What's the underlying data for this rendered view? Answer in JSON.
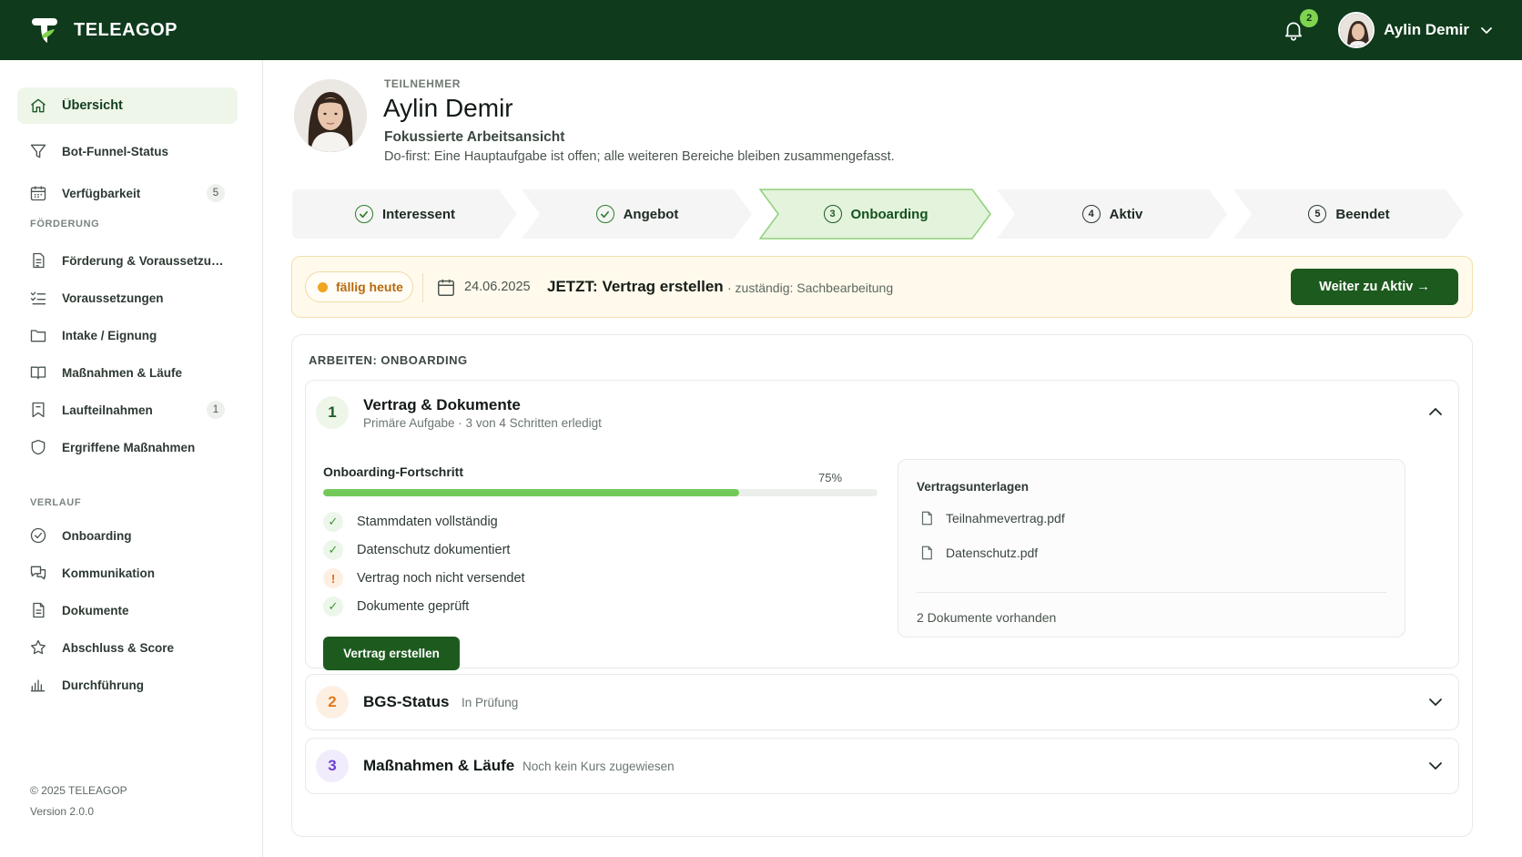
{
  "app": {
    "brand": "TELEAGOP",
    "notifications_count": "2",
    "user_name": "Aylin Demir"
  },
  "sidebar": {
    "items_top": [
      {
        "label": "Übersicht",
        "icon": "home-icon",
        "active": true
      },
      {
        "label": "Bot-Funnel-Status",
        "icon": "funnel-icon"
      },
      {
        "label": "Verfügbarkeit",
        "icon": "calendar-icon",
        "badge": "5"
      }
    ],
    "section_foerderung": "FÖRDERUNG",
    "items_foerderung": [
      {
        "label": "Förderung & Voraussetzungen",
        "icon": "document-icon"
      },
      {
        "label": "Voraussetzungen",
        "icon": "checklist-icon"
      },
      {
        "label": "Intake / Eignung",
        "icon": "folder-icon"
      },
      {
        "label": "Maßnahmen & Läufe",
        "icon": "book-icon"
      },
      {
        "label": "Laufteilnahmen",
        "icon": "bookmark-icon",
        "badge": "1"
      },
      {
        "label": "Ergriffene Maßnahmen",
        "icon": "shield-icon"
      }
    ],
    "section_verlauf": "VERLAUF",
    "items_verlauf": [
      {
        "label": "Onboarding",
        "icon": "check-circle-icon"
      },
      {
        "label": "Kommunikation",
        "icon": "chat-icon"
      },
      {
        "label": "Dokumente",
        "icon": "file-icon"
      },
      {
        "label": "Abschluss & Score",
        "icon": "star-icon"
      },
      {
        "label": "Durchführung",
        "icon": "bar-chart-icon"
      }
    ],
    "footer_copyright": "© 2025 TELEAGOP",
    "footer_version": "Version 2.0.0"
  },
  "profile": {
    "kicker": "TEILNEHMER",
    "name": "Aylin Demir",
    "subtitle": "Fokussierte Arbeitsansicht",
    "description": "Do-first: Eine Hauptaufgabe ist offen; alle weiteren Bereiche bleiben zusammengefasst."
  },
  "stepper": [
    {
      "label": "Interessent",
      "marker": "check",
      "state": "done"
    },
    {
      "label": "Angebot",
      "marker": "check",
      "state": "done"
    },
    {
      "label": "Onboarding",
      "marker": "3",
      "state": "current"
    },
    {
      "label": "Aktiv",
      "marker": "4",
      "state": "upcoming"
    },
    {
      "label": "Beendet",
      "marker": "5",
      "state": "upcoming"
    }
  ],
  "alert": {
    "due_label": "fällig heute",
    "date": "24.06.2025",
    "title": "JETZT: Vertrag erstellen",
    "responsible": "· zuständig: Sachbearbeitung",
    "button": "Weiter zu Aktiv →"
  },
  "work": {
    "title": "ARBEITEN: ONBOARDING",
    "card1": {
      "number": "1",
      "title": "Vertrag & Dokumente",
      "subtitle": "Primäre Aufgabe · 3 von 4 Schritten erledigt",
      "progress_label": "Onboarding-Fortschritt",
      "progress_value": 75,
      "progress_text": "75%",
      "checklist": [
        {
          "text": "Stammdaten vollständig",
          "status": "ok",
          "glyph": "✓"
        },
        {
          "text": "Datenschutz dokumentiert",
          "status": "ok",
          "glyph": "✓"
        },
        {
          "text": "Vertrag noch nicht versendet",
          "status": "warn",
          "glyph": "!"
        },
        {
          "text": "Dokumente geprüft",
          "status": "ok",
          "glyph": "✓"
        }
      ],
      "button": "Vertrag erstellen",
      "docs_title": "Vertragsunterlagen",
      "docs": [
        "Teilnahmevertrag.pdf",
        "Datenschutz.pdf"
      ],
      "docs_count": "2 Dokumente vorhanden"
    },
    "card2": {
      "number": "2",
      "title": "BGS-Status",
      "status": "In Prüfung"
    },
    "card3": {
      "number": "3",
      "title": "Maßnahmen & Läufe",
      "status": "Noch kein Kurs zugewiesen"
    }
  },
  "colors": {
    "topbar": "#0f3a1c",
    "primary_button": "#1d5a1e",
    "progress": "#72c95a",
    "due": "#f0a420",
    "card2_accent": "#e27a1d",
    "card3_accent": "#6a3fd6"
  }
}
